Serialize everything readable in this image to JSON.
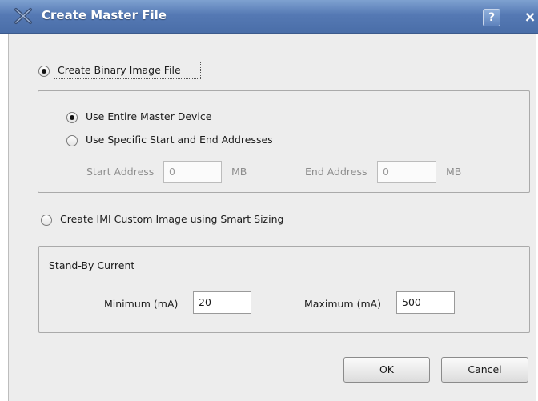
{
  "window": {
    "title": "Create Master File",
    "help_label": "?",
    "close_label": "×"
  },
  "binary_option": {
    "label": "Create Binary Image File",
    "selected": true
  },
  "binary_group": {
    "entire_device": {
      "label": "Use Entire Master Device",
      "selected": true
    },
    "specific_addresses": {
      "label": "Use Specific Start and End Addresses",
      "selected": false
    },
    "start_address": {
      "label": "Start Address",
      "value": "0",
      "unit": "MB"
    },
    "end_address": {
      "label": "End Address",
      "value": "0",
      "unit": "MB"
    }
  },
  "imi_option": {
    "label": "Create IMI Custom Image using Smart Sizing",
    "selected": false
  },
  "standby_group": {
    "title": "Stand-By Current",
    "minimum": {
      "label": "Minimum (mA)",
      "value": "20"
    },
    "maximum": {
      "label": "Maximum (mA)",
      "value": "500"
    }
  },
  "buttons": {
    "ok": "OK",
    "cancel": "Cancel"
  }
}
